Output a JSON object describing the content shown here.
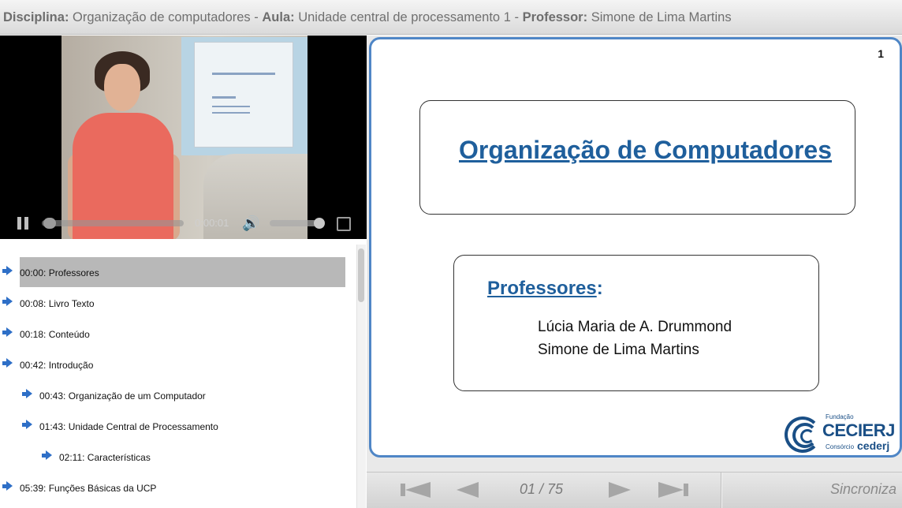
{
  "header": {
    "discipline_label": "Disciplina:",
    "discipline": "Organização de computadores",
    "sep1": "-",
    "lesson_label": "Aula:",
    "lesson": "Unidade central de processamento 1",
    "sep2": "-",
    "professor_label": "Professor:",
    "professor": "Simone de Lima Martins"
  },
  "video": {
    "time": "0:00:01",
    "progress_percent": 0,
    "volume_percent": 100,
    "pause_icon": "pause-icon",
    "volume_icon": "volume-icon",
    "fullscreen_icon": "fullscreen-icon"
  },
  "chapters": [
    {
      "label": "00:00: Professores",
      "level": 0,
      "active": true
    },
    {
      "label": "00:08: Livro Texto",
      "level": 0,
      "active": false
    },
    {
      "label": "00:18: Conteúdo",
      "level": 0,
      "active": false
    },
    {
      "label": "00:42: Introdução",
      "level": 0,
      "active": false
    },
    {
      "label": "00:43: Organização de um Computador",
      "level": 1,
      "active": false
    },
    {
      "label": "01:43: Unidade Central de Processamento",
      "level": 1,
      "active": false
    },
    {
      "label": "02:11: Características",
      "level": 2,
      "active": false
    },
    {
      "label": "05:39: Funções Básicas da UCP",
      "level": 0,
      "active": false
    }
  ],
  "slide": {
    "number": "1",
    "title": "Organização de Computadores",
    "professors_label": "Professores",
    "professors_colon": ":",
    "professors": [
      "Lúcia Maria de A. Drummond",
      "Simone de Lima Martins"
    ],
    "logo": {
      "top": "Fundação",
      "name": "CECIERJ",
      "bottom_left": "Consórcio",
      "bottom_right": "cederj"
    }
  },
  "nav": {
    "page_indicator": "01 / 75",
    "sync_label": "Sincroniza",
    "colors": {
      "button": "#a6a6a6"
    }
  }
}
